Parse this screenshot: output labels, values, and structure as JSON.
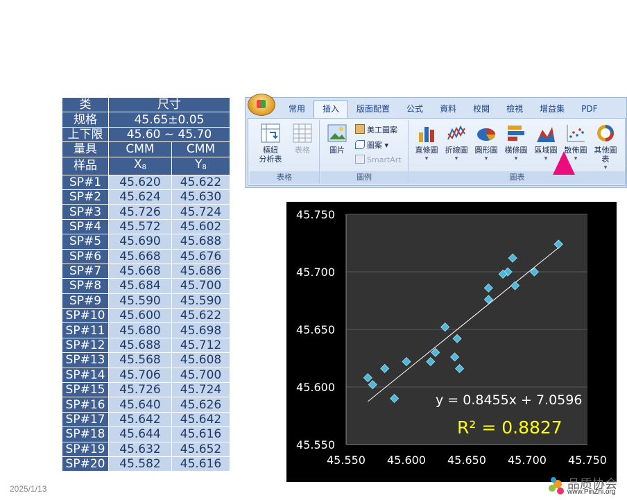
{
  "table": {
    "header": {
      "category_label": "类",
      "dimension_label": "尺寸",
      "spec_label": "规格",
      "spec_value": "45.65±0.05",
      "limits_label": "上下限",
      "limits_value": "45.60 ~ 45.70",
      "gauge_label": "量具",
      "gauge_x": "CMM",
      "gauge_y": "CMM",
      "sample_label": "样品",
      "col_x": "X",
      "col_x_sub": "8",
      "col_y": "Y",
      "col_y_sub": "8"
    },
    "rows": [
      {
        "id": "SP#1",
        "x": "45.620",
        "y": "45.622"
      },
      {
        "id": "SP#2",
        "x": "45.624",
        "y": "45.630"
      },
      {
        "id": "SP#3",
        "x": "45.726",
        "y": "45.724"
      },
      {
        "id": "SP#4",
        "x": "45.572",
        "y": "45.602"
      },
      {
        "id": "SP#5",
        "x": "45.690",
        "y": "45.688"
      },
      {
        "id": "SP#6",
        "x": "45.668",
        "y": "45.676"
      },
      {
        "id": "SP#7",
        "x": "45.668",
        "y": "45.686"
      },
      {
        "id": "SP#8",
        "x": "45.684",
        "y": "45.700"
      },
      {
        "id": "SP#9",
        "x": "45.590",
        "y": "45.590"
      },
      {
        "id": "SP#10",
        "x": "45.600",
        "y": "45.622"
      },
      {
        "id": "SP#11",
        "x": "45.680",
        "y": "45.698"
      },
      {
        "id": "SP#12",
        "x": "45.688",
        "y": "45.712"
      },
      {
        "id": "SP#13",
        "x": "45.568",
        "y": "45.608"
      },
      {
        "id": "SP#14",
        "x": "45.706",
        "y": "45.700"
      },
      {
        "id": "SP#15",
        "x": "45.726",
        "y": "45.724"
      },
      {
        "id": "SP#16",
        "x": "45.640",
        "y": "45.626"
      },
      {
        "id": "SP#17",
        "x": "45.642",
        "y": "45.642"
      },
      {
        "id": "SP#18",
        "x": "45.644",
        "y": "45.616"
      },
      {
        "id": "SP#19",
        "x": "45.632",
        "y": "45.652"
      },
      {
        "id": "SP#20",
        "x": "45.582",
        "y": "45.616"
      }
    ]
  },
  "ribbon": {
    "tabs": [
      "常用",
      "插入",
      "版面配置",
      "公式",
      "資料",
      "校閱",
      "檢視",
      "增益集",
      "PDF"
    ],
    "active_tab": "插入",
    "groups": {
      "tables": {
        "label": "表格",
        "pivot": "樞紐\n分析表",
        "table": "表格"
      },
      "illustrations": {
        "label": "圖例",
        "picture": "圖片",
        "clipart": "美工圖案",
        "shapes": "圖案",
        "smartart": "SmartArt"
      },
      "charts": {
        "label": "圖表",
        "items": [
          "直條圖",
          "折線圖",
          "圓形圖",
          "橫條圖",
          "區域圖",
          "散佈圖",
          "其他圖表"
        ]
      }
    },
    "highlight_color": "#ec0c7c",
    "icons": {
      "pivot": "pivot-table-icon",
      "table": "table-icon",
      "picture": "picture-icon",
      "clipart": "clipart-icon",
      "shapes": "shapes-icon",
      "smartart": "smartart-icon",
      "column": "column-chart-icon",
      "line": "line-chart-icon",
      "pie": "pie-chart-icon",
      "bar": "bar-chart-icon",
      "area": "area-chart-icon",
      "scatter": "scatter-chart-icon",
      "other": "other-charts-icon"
    }
  },
  "chart_data": {
    "type": "scatter",
    "title": "",
    "xlabel": "",
    "ylabel": "",
    "xlim": [
      45.55,
      45.75
    ],
    "ylim": [
      45.55,
      45.75
    ],
    "x_ticks": [
      "45.550",
      "45.600",
      "45.650",
      "45.700",
      "45.750"
    ],
    "y_ticks": [
      "45.550",
      "45.600",
      "45.650",
      "45.700",
      "45.750"
    ],
    "grid": true,
    "background": "#000000",
    "plot_background": "#333333",
    "marker_color": "#4fb8d8",
    "points": [
      {
        "x": 45.62,
        "y": 45.622
      },
      {
        "x": 45.624,
        "y": 45.63
      },
      {
        "x": 45.726,
        "y": 45.724
      },
      {
        "x": 45.572,
        "y": 45.602
      },
      {
        "x": 45.69,
        "y": 45.688
      },
      {
        "x": 45.668,
        "y": 45.676
      },
      {
        "x": 45.668,
        "y": 45.686
      },
      {
        "x": 45.684,
        "y": 45.7
      },
      {
        "x": 45.59,
        "y": 45.59
      },
      {
        "x": 45.6,
        "y": 45.622
      },
      {
        "x": 45.68,
        "y": 45.698
      },
      {
        "x": 45.688,
        "y": 45.712
      },
      {
        "x": 45.568,
        "y": 45.608
      },
      {
        "x": 45.706,
        "y": 45.7
      },
      {
        "x": 45.726,
        "y": 45.724
      },
      {
        "x": 45.64,
        "y": 45.626
      },
      {
        "x": 45.642,
        "y": 45.642
      },
      {
        "x": 45.644,
        "y": 45.616
      },
      {
        "x": 45.632,
        "y": 45.652
      },
      {
        "x": 45.582,
        "y": 45.616
      }
    ],
    "trendline": {
      "slope": 0.8455,
      "intercept": 7.0596,
      "x_start": 45.568,
      "x_end": 45.726
    },
    "equation_text": "y = 0.8455x + 7.0596",
    "r2_text": "R² = 0.8827",
    "r2_color": "#ffff00"
  },
  "footer": {
    "date": "2025/1/13",
    "logo_text": "品质协会",
    "logo_url": "www.PinZhi.org"
  }
}
